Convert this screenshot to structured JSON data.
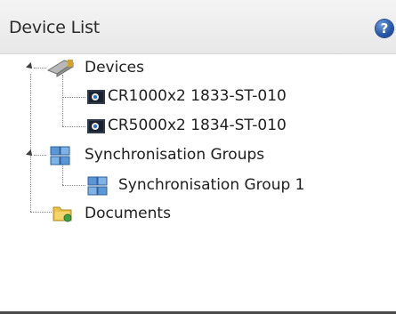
{
  "panel": {
    "title": "Device List",
    "help_icon": "help-icon",
    "help_glyph": "?"
  },
  "tree": {
    "devices": {
      "label": "Devices",
      "icon": "devices-icon",
      "expanded": true,
      "children": [
        {
          "label": "CR1000x2 1833-ST-010",
          "icon": "device-icon"
        },
        {
          "label": "CR5000x2 1834-ST-010",
          "icon": "device-icon"
        }
      ]
    },
    "sync_groups": {
      "label": "Synchronisation Groups",
      "icon": "sync-groups-icon",
      "expanded": true,
      "children": [
        {
          "label": "Synchronisation Group 1",
          "icon": "sync-group-icon"
        }
      ]
    },
    "documents": {
      "label": "Documents",
      "icon": "documents-folder-icon"
    }
  },
  "colors": {
    "header_bg": "#eeeeee",
    "help_blue": "#2456a8",
    "text": "#1e1e1e"
  }
}
